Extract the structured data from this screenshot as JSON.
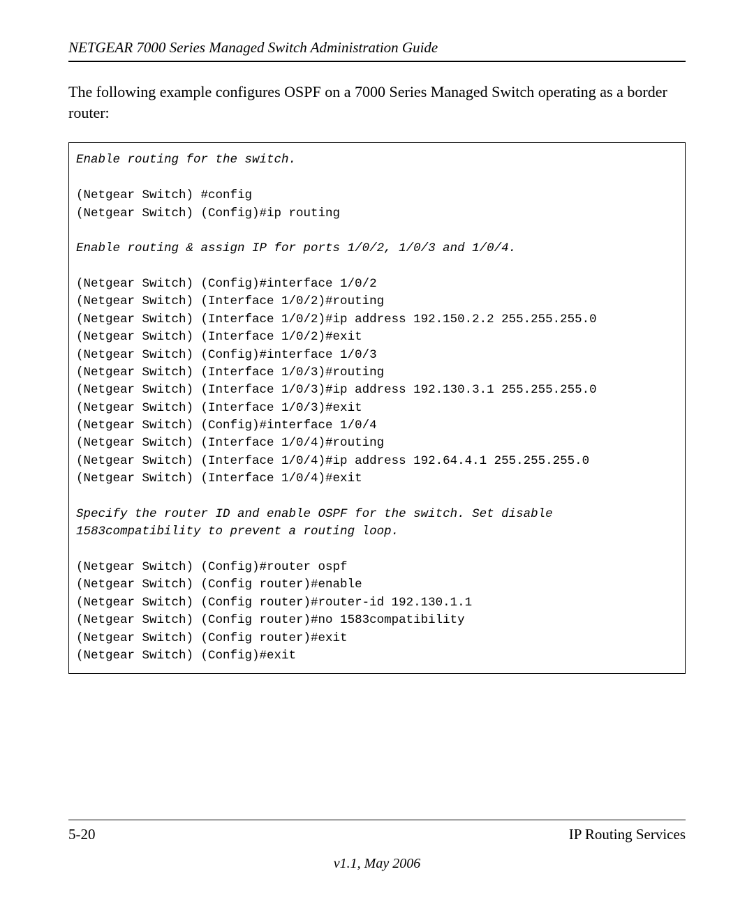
{
  "header": {
    "running_title": "NETGEAR 7000  Series Managed Switch Administration Guide"
  },
  "body": {
    "intro": "The following example configures OSPF on a 7000 Series Managed Switch operating as a border router:"
  },
  "code": {
    "block1_comment": "Enable routing for the switch.",
    "block1_lines": "(Netgear Switch) #config\n(Netgear Switch) (Config)#ip routing",
    "block2_comment": "Enable routing & assign IP for ports 1/0/2, 1/0/3 and 1/0/4.",
    "block2_lines": "(Netgear Switch) (Config)#interface 1/0/2\n(Netgear Switch) (Interface 1/0/2)#routing\n(Netgear Switch) (Interface 1/0/2)#ip address 192.150.2.2 255.255.255.0\n(Netgear Switch) (Interface 1/0/2)#exit\n(Netgear Switch) (Config)#interface 1/0/3\n(Netgear Switch) (Interface 1/0/3)#routing\n(Netgear Switch) (Interface 1/0/3)#ip address 192.130.3.1 255.255.255.0\n(Netgear Switch) (Interface 1/0/3)#exit\n(Netgear Switch) (Config)#interface 1/0/4\n(Netgear Switch) (Interface 1/0/4)#routing\n(Netgear Switch) (Interface 1/0/4)#ip address 192.64.4.1 255.255.255.0\n(Netgear Switch) (Interface 1/0/4)#exit",
    "block3_comment": "Specify the router ID and enable OSPF for the switch. Set disable \n1583compatibility to prevent a routing loop.",
    "block3_lines": "(Netgear Switch) (Config)#router ospf\n(Netgear Switch) (Config router)#enable\n(Netgear Switch) (Config router)#router-id 192.130.1.1\n(Netgear Switch) (Config router)#no 1583compatibility\n(Netgear Switch) (Config router)#exit\n(Netgear Switch) (Config)#exit"
  },
  "footer": {
    "page_number": "5-20",
    "section": "IP Routing Services",
    "version": "v1.1, May 2006"
  }
}
